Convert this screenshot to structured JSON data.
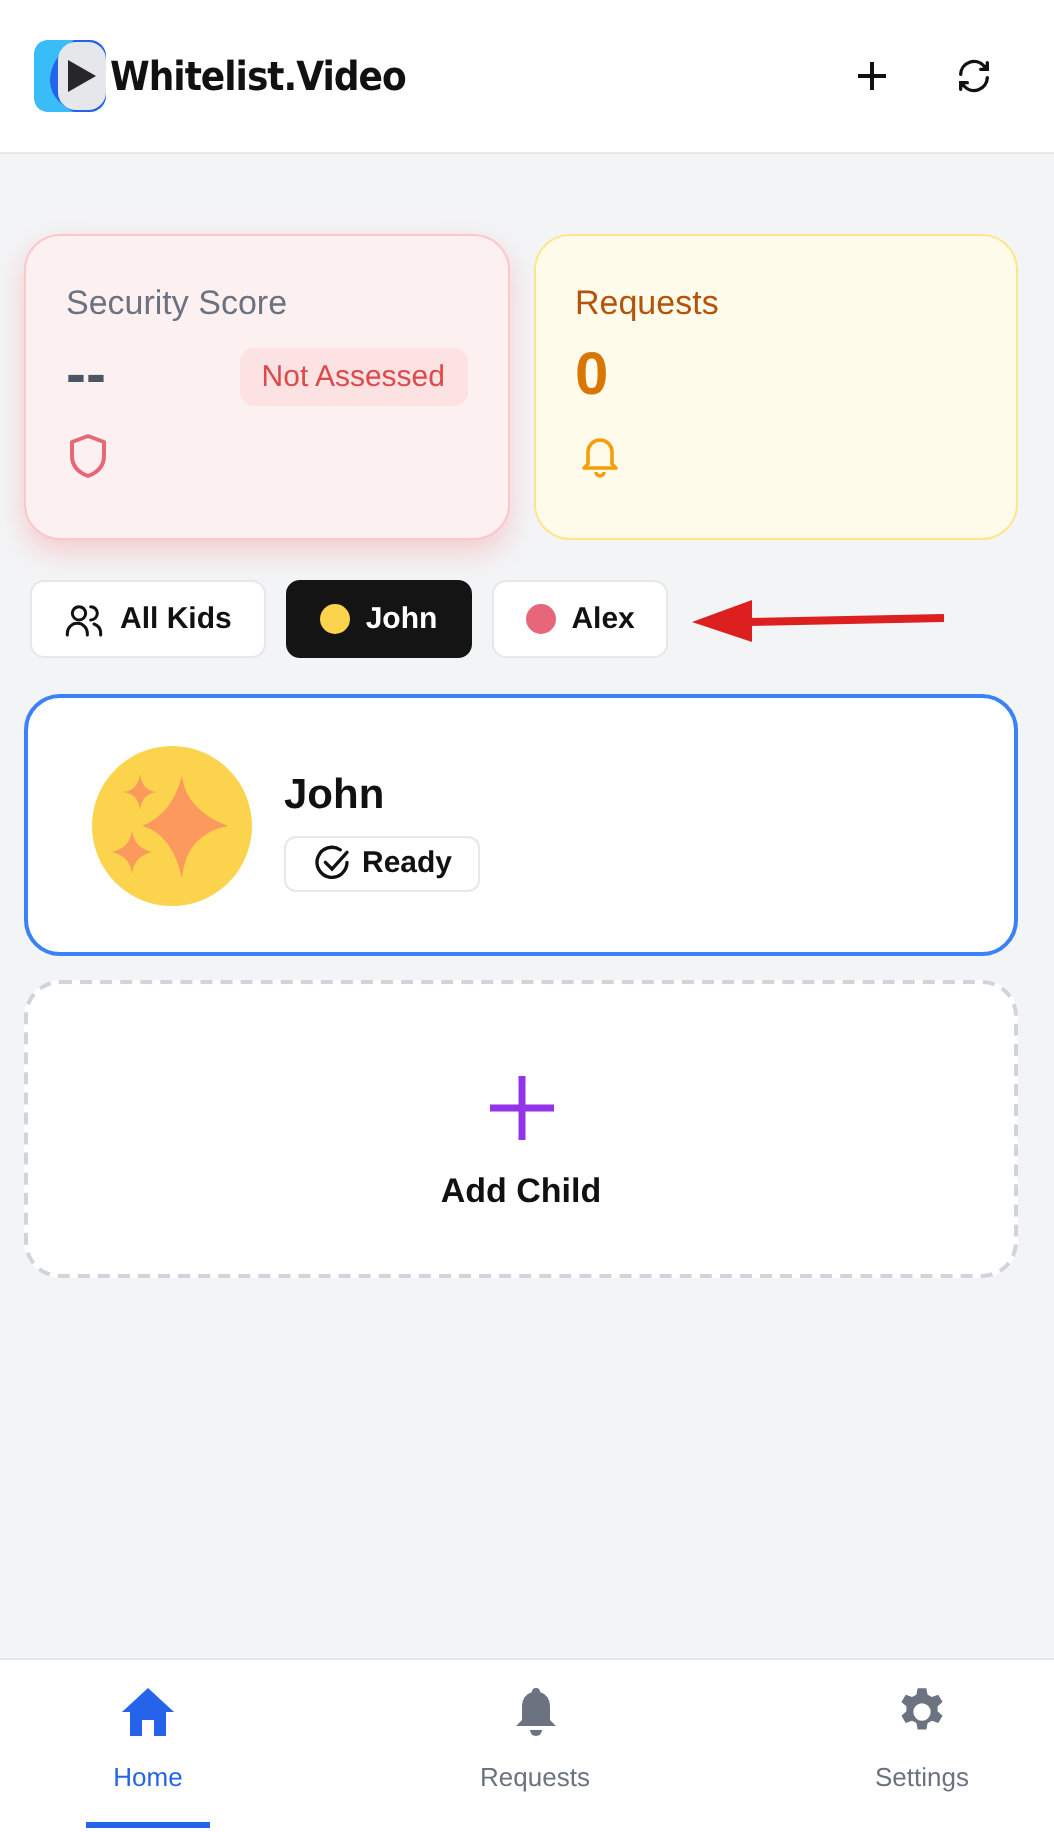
{
  "header": {
    "brand": "Whitelist.Video"
  },
  "security": {
    "title": "Security Score",
    "value": "--",
    "badge": "Not Assessed"
  },
  "requests": {
    "title": "Requests",
    "value": "0"
  },
  "filters": [
    {
      "kind": "all",
      "label": "All Kids",
      "selected": false
    },
    {
      "kind": "child",
      "label": "John",
      "selected": true,
      "color": "#fcd34d"
    },
    {
      "kind": "child",
      "label": "Alex",
      "selected": false,
      "color": "#e8667a"
    }
  ],
  "children": [
    {
      "name": "John",
      "status": "Ready",
      "selected": true
    }
  ],
  "add_child": {
    "label": "Add Child"
  },
  "nav": [
    {
      "kind": "home",
      "label": "Home",
      "selected": true
    },
    {
      "kind": "bell",
      "label": "Requests",
      "selected": false
    },
    {
      "kind": "gear",
      "label": "Settings",
      "selected": false
    }
  ]
}
